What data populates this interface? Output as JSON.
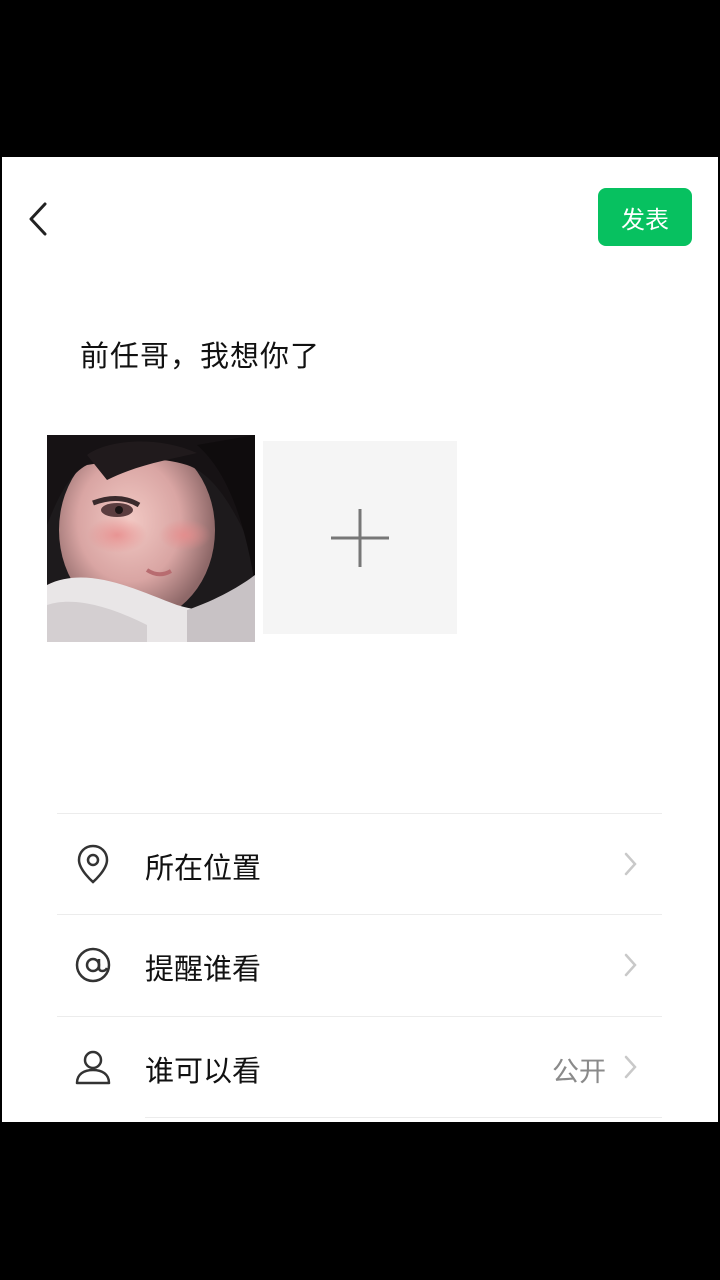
{
  "header": {
    "publish_label": "发表"
  },
  "post": {
    "text": "前任哥，我想你了"
  },
  "options": [
    {
      "label": "所在位置",
      "value": "",
      "icon": "location-pin-icon"
    },
    {
      "label": "提醒谁看",
      "value": "",
      "icon": "at-sign-icon"
    },
    {
      "label": "谁可以看",
      "value": "公开",
      "icon": "person-icon"
    }
  ],
  "colors": {
    "accent": "#07c160",
    "background": "#ffffff",
    "letterbox": "#000000"
  }
}
